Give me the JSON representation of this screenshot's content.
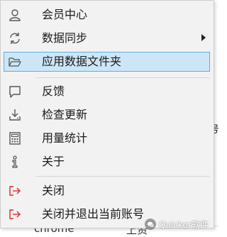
{
  "menu": {
    "items": [
      {
        "label": "会员中心",
        "icon": "user-icon"
      },
      {
        "label": "数据同步",
        "icon": "sync-icon",
        "has_submenu": true
      },
      {
        "label": "应用数据文件夹",
        "icon": "folder-open-icon",
        "selected": true
      },
      {
        "label": "反馈",
        "icon": "chat-bubble-icon"
      },
      {
        "label": "检查更新",
        "icon": "download-icon"
      },
      {
        "label": "用量统计",
        "icon": "calculator-icon"
      },
      {
        "label": "关于",
        "icon": "info-icon"
      },
      {
        "label": "关闭",
        "icon": "exit-icon"
      },
      {
        "label": "关闭并退出当前账号",
        "icon": "exit-icon"
      }
    ]
  },
  "background": {
    "right_edge_glyph": "号",
    "bottom_left_text": "chrome",
    "bottom_mid_text": "上资"
  },
  "watermark": {
    "text": "Quicker软件"
  },
  "colors": {
    "menu_bg": "#f2f2f2",
    "selected_bg": "#cde6f7",
    "selected_border": "#5ab0e0",
    "exit_icon": "#e0282e",
    "icon_gray": "#555555"
  }
}
